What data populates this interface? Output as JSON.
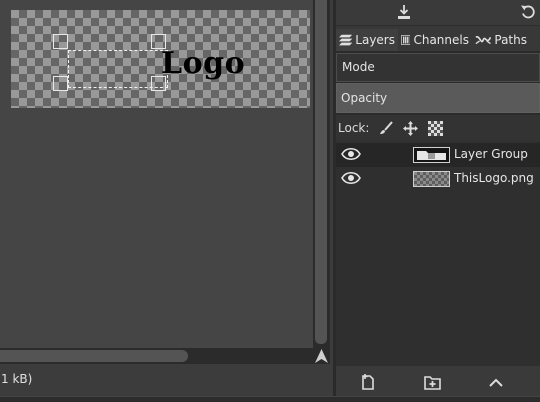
{
  "canvas": {
    "logo_text": "Logo"
  },
  "status": {
    "text": "1 kB)"
  },
  "dock": {
    "tabs": [
      {
        "label": "Layers",
        "icon": "layers-icon"
      },
      {
        "label": "Channels",
        "icon": "channels-icon"
      },
      {
        "label": "Paths",
        "icon": "paths-icon"
      }
    ],
    "mode_label": "Mode",
    "opacity_label": "Opacity",
    "lock_label": "Lock:",
    "layers": [
      {
        "name": "Layer Group",
        "visible": true,
        "selected": true
      },
      {
        "name": "ThisLogo.png",
        "visible": true,
        "selected": false
      }
    ]
  },
  "colors": {
    "panel_bg": "#383838",
    "list_bg": "#2f2f2f",
    "opacity_bg": "#5a5a5a",
    "text": "#e6e6e6"
  }
}
